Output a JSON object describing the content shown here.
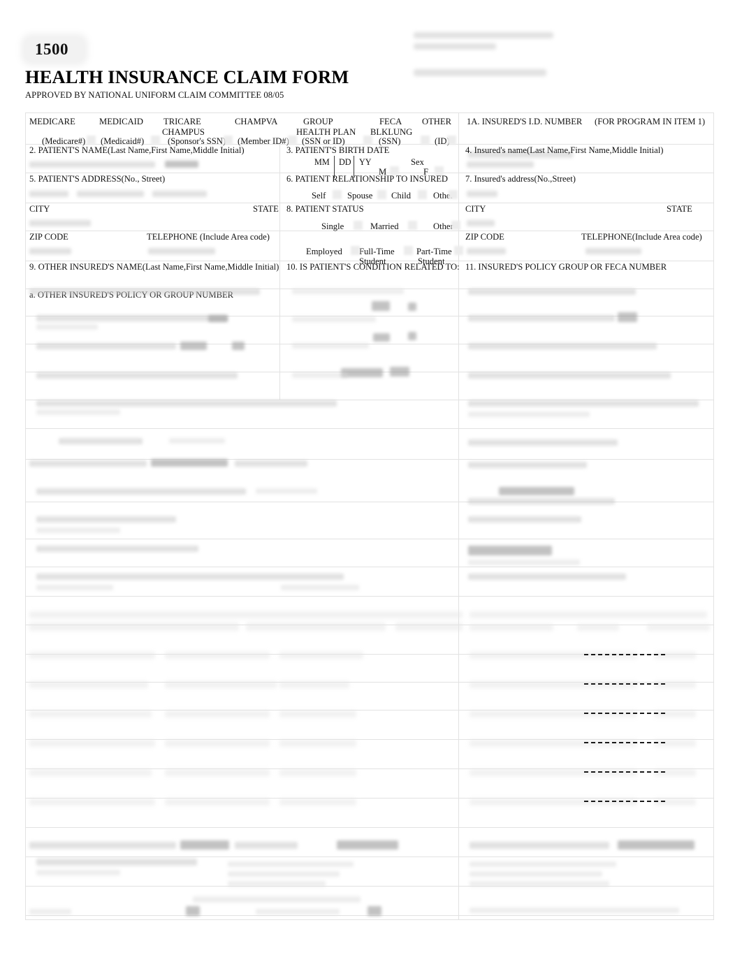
{
  "header": {
    "form_number": "1500",
    "title": "HEALTH INSURANCE CLAIM FORM",
    "subtitle": "APPROVED BY NATIONAL UNIFORM CLAIM COMMITTEE 08/05"
  },
  "carrier_block": {
    "note": "illegible faded carrier address block"
  },
  "item1": {
    "number_label": "1. MEDICARE",
    "plans": [
      {
        "name": "MEDICARE",
        "sub": "",
        "id": "(Medicare#)"
      },
      {
        "name": "MEDICAID",
        "sub": "",
        "id": "(Medicaid#)"
      },
      {
        "name": "TRICARE",
        "sub": "CHAMPUS",
        "id": "(Sponsor's SSN)"
      },
      {
        "name": "CHAMPVA",
        "sub": "",
        "id": "(Member ID#)"
      },
      {
        "name": "GROUP",
        "sub": "HEALTH PLAN",
        "id": "(SSN or ID)"
      },
      {
        "name": "FECA",
        "sub": "BLKLUNG",
        "id": "(SSN)"
      },
      {
        "name": "OTHER",
        "sub": "",
        "id": "(ID)"
      }
    ]
  },
  "item1a": {
    "label": "1A. INSURED'S I.D. NUMBER",
    "note": "(FOR PROGRAM IN ITEM 1)"
  },
  "item2": {
    "label": "2. PATIENT'S NAME(Last Name,First Name,Middle Initial)"
  },
  "item3": {
    "label": "3. PATIENT'S BIRTH DATE",
    "mm": "MM",
    "dd": "DD",
    "yy": "YY",
    "sex_label": "Sex",
    "male": "M",
    "female": "F"
  },
  "item4": {
    "label": "4. Insured's name(Last Name,First Name,Middle Initial)"
  },
  "item5": {
    "label": "5. PATIENT'S ADDRESS(No., Street)",
    "city": "CITY",
    "state": "STATE",
    "zip": "ZIP CODE",
    "telephone": "TELEPHONE (Include Area code)"
  },
  "item6": {
    "label": "6. PATIENT RELATIONSHIP TO INSURED",
    "options": [
      "Self",
      "Spouse",
      "Child",
      "Other"
    ]
  },
  "item7": {
    "label": "7. Insured's address(No.,Street)",
    "city": "CITY",
    "state": "STATE",
    "zip": "ZIP CODE",
    "telephone": "TELEPHONE(Include Area code)"
  },
  "item8": {
    "label": "8. PATIENT STATUS",
    "marital": [
      "Single",
      "Married",
      "Other"
    ],
    "employment": [
      {
        "l1": "Employed",
        "l2": ""
      },
      {
        "l1": "Full-Time",
        "l2": "Student"
      },
      {
        "l1": "Part-Time",
        "l2": "Student"
      }
    ]
  },
  "item9": {
    "label": "9. OTHER INSURED'S NAME(Last Name,First Name,Middle Initial)",
    "sub_a": "a. OTHER INSURED'S POLICY OR GROUP NUMBER"
  },
  "item10": {
    "label": "10. IS PATIENT'S CONDITION RELATED TO:"
  },
  "item11": {
    "label": "11. INSURED'S POLICY GROUP OR FECA NUMBER"
  },
  "illegible_note": "Remainder of form (items 9b-33) is faded/blurred and unreadable in the source image",
  "npi_dash_lines": 6,
  "colors": {
    "page_background": "#ffffff",
    "text": "#111111",
    "rule": "#e2e2e2",
    "faded_ink": "#c9c9c9"
  }
}
